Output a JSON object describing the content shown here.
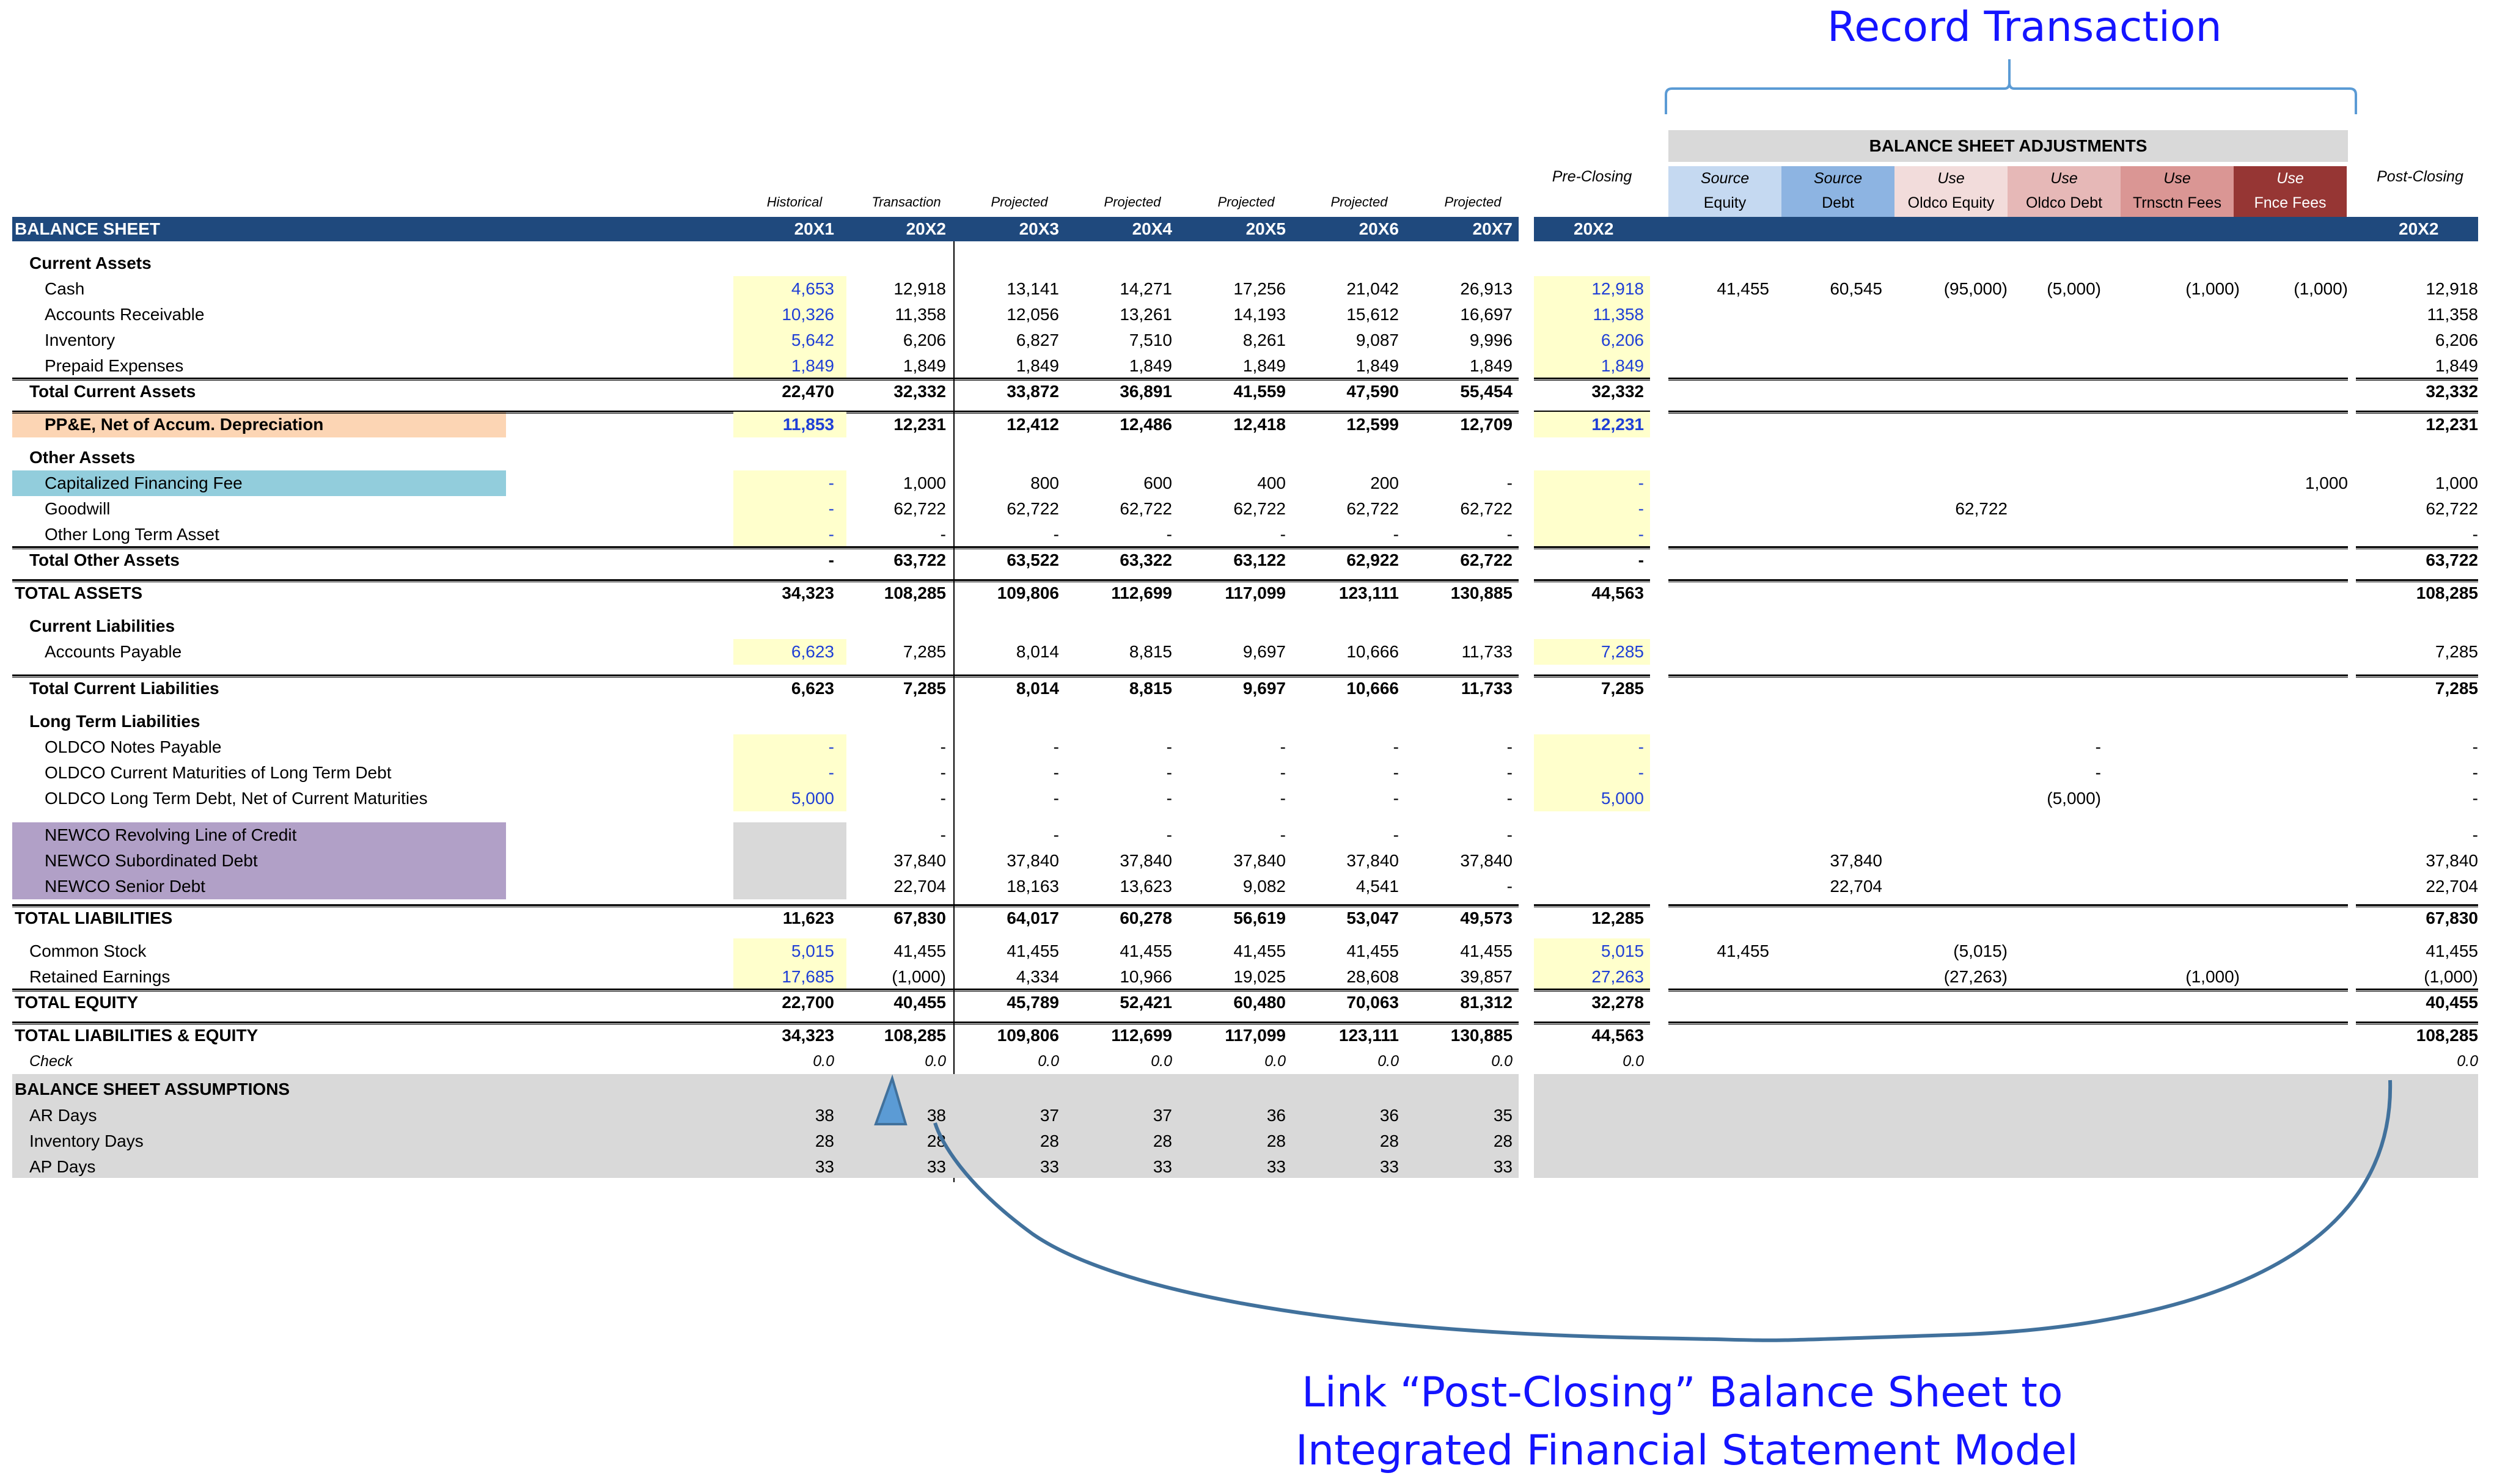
{
  "annotations": {
    "top": "Record Transaction",
    "bottom_line1": "Link “Post-Closing” Balance Sheet to",
    "bottom_line2": "Integrated Financial Statement Model",
    "arrow_color": "#41719c",
    "arrowhead_color": "#5b9bd5"
  },
  "header": {
    "title": "BALANCE SHEET",
    "period_types": [
      "Historical",
      "Transaction",
      "Projected",
      "Projected",
      "Projected",
      "Projected",
      "Projected"
    ],
    "years": [
      "20X1",
      "20X2",
      "20X3",
      "20X4",
      "20X5",
      "20X6",
      "20X7"
    ],
    "pre_closing_label": "Pre-Closing",
    "pre_closing_year": "20X2",
    "post_closing_label": "Post-Closing",
    "post_closing_year": "20X2",
    "adjustments_title": "BALANCE SHEET ADJUSTMENTS",
    "adjustments": [
      {
        "top": "Source",
        "bottom": "Equity",
        "color": "#c5d9f1"
      },
      {
        "top": "Source",
        "bottom": "Debt",
        "color": "#8db4e2"
      },
      {
        "top": "Use",
        "bottom": "Oldco Equity",
        "color": "#f2dcdb"
      },
      {
        "top": "Use",
        "bottom": "Oldco Debt",
        "color": "#e6b8b7"
      },
      {
        "top": "Use",
        "bottom": "Trnsctn Fees",
        "color": "#da9694"
      },
      {
        "top": "Use",
        "bottom": "Fnce Fees",
        "color": "#963634"
      }
    ],
    "bar_color": "#1f497d"
  },
  "rows": [
    {
      "id": "current-assets",
      "label": "Current Assets",
      "style": "section"
    },
    {
      "id": "cash",
      "label": "Cash",
      "vals": [
        "4,653",
        "12,918",
        "13,141",
        "14,271",
        "17,256",
        "21,042",
        "26,913"
      ],
      "pre": "12,918",
      "adj": [
        "41,455",
        "60,545",
        "(95,000)",
        "(5,000)",
        "(1,000)",
        "(1,000)"
      ],
      "post": "12,918"
    },
    {
      "id": "accounts-receivable",
      "label": "Accounts Receivable",
      "vals": [
        "10,326",
        "11,358",
        "12,056",
        "13,261",
        "14,193",
        "15,612",
        "16,697"
      ],
      "pre": "11,358",
      "adj": [
        "",
        "",
        "",
        "",
        "",
        ""
      ],
      "post": "11,358"
    },
    {
      "id": "inventory",
      "label": "Inventory",
      "vals": [
        "5,642",
        "6,206",
        "6,827",
        "7,510",
        "8,261",
        "9,087",
        "9,996"
      ],
      "pre": "6,206",
      "adj": [
        "",
        "",
        "",
        "",
        "",
        ""
      ],
      "post": "6,206"
    },
    {
      "id": "prepaid-expenses",
      "label": "Prepaid Expenses",
      "vals": [
        "1,849",
        "1,849",
        "1,849",
        "1,849",
        "1,849",
        "1,849",
        "1,849"
      ],
      "pre": "1,849",
      "adj": [
        "",
        "",
        "",
        "",
        "",
        ""
      ],
      "post": "1,849"
    },
    {
      "id": "total-current-assets",
      "label": "Total Current Assets",
      "style": "total",
      "vals": [
        "22,470",
        "32,332",
        "33,872",
        "36,891",
        "41,559",
        "47,590",
        "55,454"
      ],
      "pre": "32,332",
      "adj": [
        "",
        "",
        "",
        "",
        "",
        ""
      ],
      "post": "32,332"
    },
    {
      "id": "ppe",
      "label": "PP&E, Net of Accum. Depreciation",
      "style": "total",
      "highlight": "#fcd5b4",
      "vals": [
        "11,853",
        "12,231",
        "12,412",
        "12,486",
        "12,418",
        "12,599",
        "12,709"
      ],
      "pre": "12,231",
      "adj": [
        "",
        "",
        "",
        "",
        "",
        ""
      ],
      "post": "12,231"
    },
    {
      "id": "other-assets",
      "label": "Other Assets",
      "style": "section"
    },
    {
      "id": "capitalized-financing-fee",
      "label": "Capitalized Financing Fee",
      "highlight": "#92cddc",
      "vals": [
        "-",
        "1,000",
        "800",
        "600",
        "400",
        "200",
        "-"
      ],
      "pre": "-",
      "adj": [
        "",
        "",
        "",
        "",
        "",
        "1,000"
      ],
      "post": "1,000"
    },
    {
      "id": "goodwill",
      "label": "Goodwill",
      "vals": [
        "-",
        "62,722",
        "62,722",
        "62,722",
        "62,722",
        "62,722",
        "62,722"
      ],
      "pre": "-",
      "adj": [
        "",
        "",
        "62,722",
        "",
        "",
        ""
      ],
      "post": "62,722"
    },
    {
      "id": "other-long-term-asset",
      "label": "Other Long Term Asset",
      "vals": [
        "-",
        "-",
        "-",
        "-",
        "-",
        "-",
        "-"
      ],
      "pre": "-",
      "adj": [
        "",
        "",
        "",
        "",
        "",
        ""
      ],
      "post": "-"
    },
    {
      "id": "total-other-assets",
      "label": "Total Other Assets",
      "style": "total",
      "vals": [
        "-",
        "63,722",
        "63,522",
        "63,322",
        "63,122",
        "62,922",
        "62,722"
      ],
      "pre": "-",
      "adj": [
        "",
        "",
        "",
        "",
        "",
        ""
      ],
      "post": "63,722"
    },
    {
      "id": "total-assets",
      "label": "TOTAL ASSETS",
      "style": "grand",
      "vals": [
        "34,323",
        "108,285",
        "109,806",
        "112,699",
        "117,099",
        "123,111",
        "130,885"
      ],
      "pre": "44,563",
      "adj": [
        "",
        "",
        "",
        "",
        "",
        ""
      ],
      "post": "108,285"
    },
    {
      "id": "current-liabilities",
      "label": "Current Liabilities",
      "style": "section"
    },
    {
      "id": "accounts-payable",
      "label": "Accounts Payable",
      "vals": [
        "6,623",
        "7,285",
        "8,014",
        "8,815",
        "9,697",
        "10,666",
        "11,733"
      ],
      "pre": "7,285",
      "adj": [
        "",
        "",
        "",
        "",
        "",
        ""
      ],
      "post": "7,285"
    },
    {
      "id": "total-current-liabilities",
      "label": "Total Current Liabilities",
      "style": "total",
      "vals": [
        "6,623",
        "7,285",
        "8,014",
        "8,815",
        "9,697",
        "10,666",
        "11,733"
      ],
      "pre": "7,285",
      "adj": [
        "",
        "",
        "",
        "",
        "",
        ""
      ],
      "post": "7,285"
    },
    {
      "id": "long-term-liabilities",
      "label": "Long Term Liabilities",
      "style": "section"
    },
    {
      "id": "oldco-notes-payable",
      "label": "OLDCO Notes Payable",
      "vals": [
        "-",
        "-",
        "-",
        "-",
        "-",
        "-",
        "-"
      ],
      "pre": "-",
      "adj": [
        "",
        "",
        "",
        "-",
        "",
        ""
      ],
      "post": "-"
    },
    {
      "id": "oldco-current-maturities",
      "label": "OLDCO Current Maturities of Long Term Debt",
      "vals": [
        "-",
        "-",
        "-",
        "-",
        "-",
        "-",
        "-"
      ],
      "pre": "-",
      "adj": [
        "",
        "",
        "",
        "-",
        "",
        ""
      ],
      "post": "-"
    },
    {
      "id": "oldco-long-term-debt",
      "label": "OLDCO Long Term Debt, Net of Current Maturities",
      "vals": [
        "5,000",
        "-",
        "-",
        "-",
        "-",
        "-",
        "-"
      ],
      "pre": "5,000",
      "adj": [
        "",
        "",
        "",
        "(5,000)",
        "",
        ""
      ],
      "post": "-"
    },
    {
      "id": "newco-revolver",
      "label": "NEWCO Revolving Line of Credit",
      "highlight": "#b1a0c7",
      "vals": [
        "",
        "-",
        "-",
        "-",
        "-",
        "-",
        "-"
      ],
      "pre": "",
      "adj": [
        "",
        "",
        "",
        "",
        "",
        ""
      ],
      "post": "-"
    },
    {
      "id": "newco-subordinated-debt",
      "label": "NEWCO Subordinated Debt",
      "highlight": "#b1a0c7",
      "vals": [
        "",
        "37,840",
        "37,840",
        "37,840",
        "37,840",
        "37,840",
        "37,840"
      ],
      "pre": "",
      "adj": [
        "",
        "37,840",
        "",
        "",
        "",
        ""
      ],
      "post": "37,840"
    },
    {
      "id": "newco-senior-debt",
      "label": "NEWCO Senior Debt",
      "highlight": "#b1a0c7",
      "vals": [
        "",
        "22,704",
        "18,163",
        "13,623",
        "9,082",
        "4,541",
        "-"
      ],
      "pre": "",
      "adj": [
        "",
        "22,704",
        "",
        "",
        "",
        ""
      ],
      "post": "22,704"
    },
    {
      "id": "total-liabilities",
      "label": "TOTAL LIABILITIES",
      "style": "grand",
      "vals": [
        "11,623",
        "67,830",
        "64,017",
        "60,278",
        "56,619",
        "53,047",
        "49,573"
      ],
      "pre": "12,285",
      "adj": [
        "",
        "",
        "",
        "",
        "",
        ""
      ],
      "post": "67,830"
    },
    {
      "id": "common-stock",
      "label": "Common Stock",
      "vals": [
        "5,015",
        "41,455",
        "41,455",
        "41,455",
        "41,455",
        "41,455",
        "41,455"
      ],
      "pre": "5,015",
      "adj": [
        "41,455",
        "",
        "(5,015)",
        "",
        "",
        ""
      ],
      "post": "41,455"
    },
    {
      "id": "retained-earnings",
      "label": "Retained Earnings",
      "vals": [
        "17,685",
        "(1,000)",
        "4,334",
        "10,966",
        "19,025",
        "28,608",
        "39,857"
      ],
      "pre": "27,263",
      "adj": [
        "",
        "",
        "(27,263)",
        "",
        "(1,000)",
        ""
      ],
      "post": "(1,000)"
    },
    {
      "id": "total-equity",
      "label": "TOTAL EQUITY",
      "style": "grand",
      "vals": [
        "22,700",
        "40,455",
        "45,789",
        "52,421",
        "60,480",
        "70,063",
        "81,312"
      ],
      "pre": "32,278",
      "adj": [
        "",
        "",
        "",
        "",
        "",
        ""
      ],
      "post": "40,455"
    },
    {
      "id": "total-liabilities-equity",
      "label": "TOTAL LIABILITIES & EQUITY",
      "style": "grand",
      "vals": [
        "34,323",
        "108,285",
        "109,806",
        "112,699",
        "117,099",
        "123,111",
        "130,885"
      ],
      "pre": "44,563",
      "adj": [
        "",
        "",
        "",
        "",
        "",
        ""
      ],
      "post": "108,285"
    },
    {
      "id": "check",
      "label": "Check",
      "style": "check",
      "vals": [
        "0.0",
        "0.0",
        "0.0",
        "0.0",
        "0.0",
        "0.0",
        "0.0"
      ],
      "pre": "0.0",
      "adj": [
        "",
        "",
        "",
        "",
        "",
        ""
      ],
      "post": "0.0"
    }
  ],
  "assumptions": {
    "title": "BALANCE SHEET ASSUMPTIONS",
    "rows": [
      {
        "label": "AR Days",
        "vals": [
          "38",
          "38",
          "37",
          "37",
          "36",
          "36",
          "35"
        ]
      },
      {
        "label": "Inventory Days",
        "vals": [
          "28",
          "28",
          "28",
          "28",
          "28",
          "28",
          "28"
        ]
      },
      {
        "label": "AP Days",
        "vals": [
          "33",
          "33",
          "33",
          "33",
          "33",
          "33",
          "33"
        ]
      }
    ]
  }
}
